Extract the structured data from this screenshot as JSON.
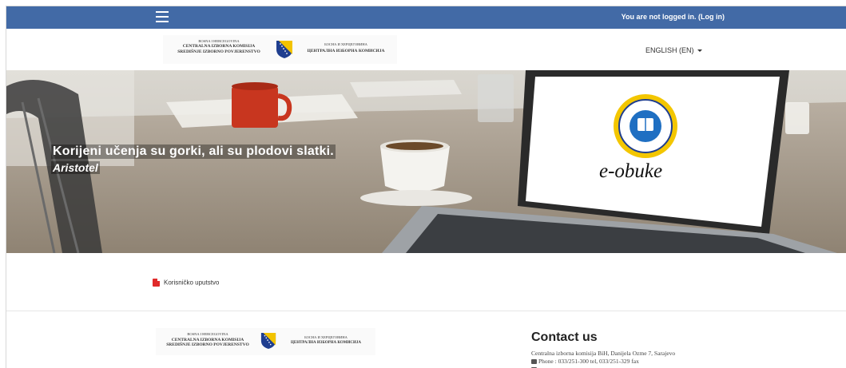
{
  "navbar": {
    "menu_icon": "hamburger-menu-icon",
    "login_status": "You are not logged in. (Log in)",
    "color": "#426aa6"
  },
  "header": {
    "logo_left": {
      "line1": "BOSNA I HERCEGOVINA",
      "line2": "CENTRALNA IZBORNA KOMISIJA",
      "line3": "SREDIŠNJE IZBORNO POVJERENSTVO"
    },
    "logo_right": {
      "line1": "БОСНА И ХЕРЦЕГОВИНА",
      "line2": "ЦЕНТРАЛНА ИЗБОРНА КОМИСИЈА"
    },
    "language": "ENGLISH (EN)"
  },
  "hero": {
    "quote": "Korijeni učenja su gorki, ali su plodovi slatki.",
    "author": "Aristotel",
    "screen_text": "e-obuke"
  },
  "content": {
    "link_icon": "pdf-icon",
    "link_label": "Korisničko uputstvo"
  },
  "footer": {
    "logo_left": {
      "line1": "BOSNA I HERCEGOVINA",
      "line2": "CENTRALNA IZBORNA KOMISIJA",
      "line3": "SREDIŠNJE IZBORNO POVJERENSTVO"
    },
    "logo_right": {
      "line1": "БОСНА И ХЕРЦЕГОВИНА",
      "line2": "ЦЕНТРАЛНА ИЗБОРНА КОМИСИЈА"
    },
    "contact_title": "Contact us",
    "address": "Centralna izborna komisija BiH, Danijela Ozme 7, Sarajevo",
    "phone": "Phone : 033/251-300 tel, 033/251-329 fax"
  }
}
